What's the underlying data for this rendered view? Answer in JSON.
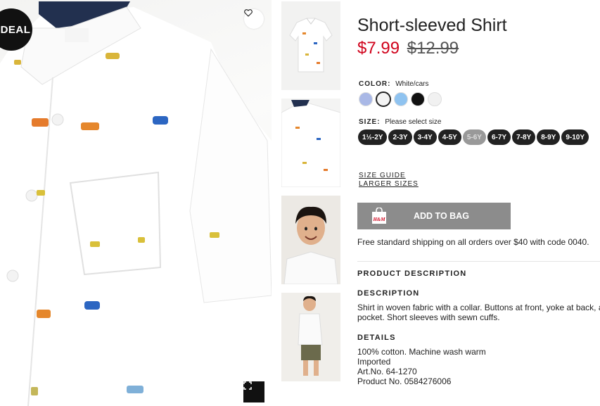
{
  "main_image": {
    "deal_badge": "DEAL",
    "brand_label": "H&M",
    "favorite_icon": "heart-icon",
    "expand_icon": "fullscreen-icon"
  },
  "thumbnails": [
    {
      "name": "shirt-flat"
    },
    {
      "name": "shirt-closeup"
    },
    {
      "name": "model-portrait"
    },
    {
      "name": "model-full"
    }
  ],
  "product": {
    "title": "Short-sleeved Shirt",
    "price_now": "$7.99",
    "price_old": "$12.99",
    "price_color": "#d0021b"
  },
  "color": {
    "label": "COLOR:",
    "selected": "White/cars",
    "swatches": [
      {
        "color": "#a9b8e6"
      },
      {
        "color": "#f4f4f4",
        "selected": true
      },
      {
        "color": "#8fc3f0"
      },
      {
        "color": "#111111"
      },
      {
        "color": "#f1f1f1"
      }
    ]
  },
  "size": {
    "label": "SIZE:",
    "prompt": "Please select size",
    "options": [
      {
        "label": "1½-2Y",
        "available": true
      },
      {
        "label": "2-3Y",
        "available": true
      },
      {
        "label": "3-4Y",
        "available": true
      },
      {
        "label": "4-5Y",
        "available": true
      },
      {
        "label": "5-6Y",
        "available": false
      },
      {
        "label": "6-7Y",
        "available": true
      },
      {
        "label": "7-8Y",
        "available": true
      },
      {
        "label": "8-9Y",
        "available": true
      },
      {
        "label": "9-10Y",
        "available": true
      }
    ]
  },
  "links": {
    "size_guide": "SIZE GUIDE",
    "larger_sizes": "LARGER SIZES"
  },
  "cart": {
    "add_label": "ADD TO BAG",
    "bag_icon": "shopping-bag-icon",
    "bag_brand": "H&M",
    "shipping_note": "Free standard shipping on all orders over $40 with code 0040."
  },
  "description": {
    "heading": "PRODUCT DESCRIPTION",
    "sub_heading": "DESCRIPTION",
    "text_line1": "Shirt in woven fabric with a collar. Buttons at front, yoke at back, a",
    "text_line2": "pocket. Short sleeves with sewn cuffs.",
    "details_heading": "DETAILS",
    "details": [
      "100% cotton. Machine wash warm",
      "Imported",
      "Art.No. 64-1270",
      "Product No. 0584276006"
    ]
  }
}
